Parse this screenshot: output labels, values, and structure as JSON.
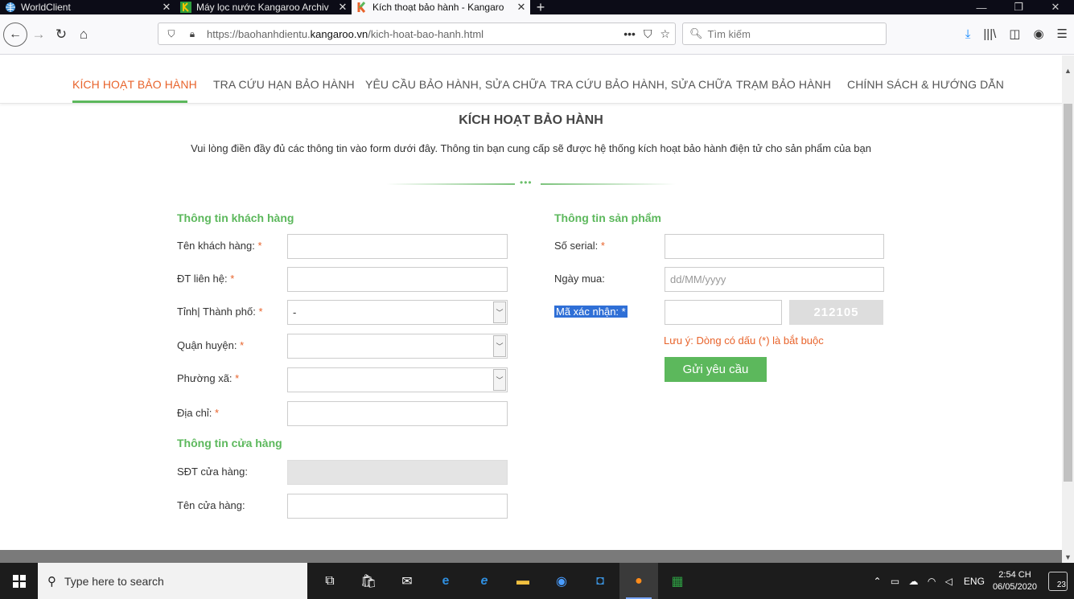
{
  "browser": {
    "tabs": [
      {
        "title": "WorldClient",
        "active": false
      },
      {
        "title": "Máy lọc nước Kangaroo Archiv",
        "active": false
      },
      {
        "title": "Kích thoạt bảo hành - Kangaro",
        "active": true
      }
    ],
    "new_tab": "+",
    "close_glyph": "✕",
    "url_prefix": "https://baohanhdientu.",
    "url_domain": "kangaroo.vn",
    "url_path": "/kich-hoat-bao-hanh.html",
    "search_placeholder": "Tìm kiếm",
    "accent": "#0a84ff"
  },
  "site_nav": {
    "items": [
      {
        "label": "KÍCH HOẠT BẢO HÀNH",
        "active": true
      },
      {
        "label": "TRA CỨU HẠN BẢO HÀNH",
        "active": false
      },
      {
        "label": "YÊU CẦU BẢO HÀNH, SỬA CHỮA",
        "active": false
      },
      {
        "label": "TRA CỨU BẢO HÀNH, SỬA CHỮA",
        "active": false
      },
      {
        "label": "TRẠM BẢO HÀNH",
        "active": false
      },
      {
        "label": "CHÍNH SÁCH & HƯỚNG DẪN",
        "active": false
      }
    ],
    "active_color": "#e8632b",
    "underline_color": "#5cb85c"
  },
  "page": {
    "title": "KÍCH HOẠT BẢO HÀNH",
    "subtitle": "Vui lòng điền đầy đủ các thông tin vào form dưới đây. Thông tin bạn cung cấp sẽ được hệ thống kích hoạt bảo hành điện tử cho sản phẩm của bạn",
    "divider_dots": "•••"
  },
  "customer": {
    "heading": "Thông tin khách hàng",
    "name_label": "Tên khách hàng:",
    "phone_label": "ĐT liên hệ:",
    "city_label": "Tỉnh| Thành phố:",
    "city_value": "-",
    "district_label": "Quận huyện:",
    "ward_label": "Phường xã:",
    "address_label": "Địa chỉ:",
    "required_mark": "*"
  },
  "store": {
    "heading": "Thông tin cửa hàng",
    "phone_label": "SĐT cửa hàng:",
    "name_label": "Tên cửa hàng:"
  },
  "product": {
    "heading": "Thông tin sản phẩm",
    "serial_label": "Số serial:",
    "date_label": "Ngày mua:",
    "date_placeholder": "dd/MM/yyyy",
    "captcha_label": "Mã xác nhận: *",
    "captcha_code": "212105",
    "note": "Lưu ý: Dòng có dấu (*) là bắt buộc",
    "submit_label": "Gửi yêu cầu",
    "heading_color": "#5cb85c"
  },
  "taskbar": {
    "search_placeholder": "Type here to search",
    "lang": "ENG",
    "time": "2:54 CH",
    "date": "06/05/2020",
    "notifications": "23"
  }
}
